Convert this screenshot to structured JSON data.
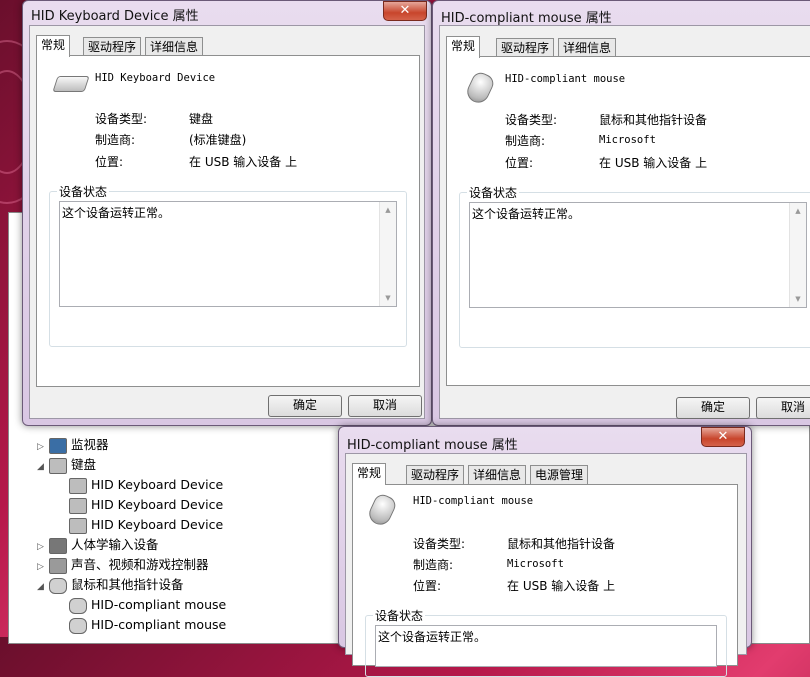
{
  "colors": {
    "accent": "#c8452c",
    "window_frame": "#d9c7e3"
  },
  "device_manager": {
    "tree": [
      {
        "label": "监视器",
        "indent": 0,
        "expanded": false,
        "icon": "monitor-icon"
      },
      {
        "label": "键盘",
        "indent": 0,
        "expanded": true,
        "icon": "keyboard-icon"
      },
      {
        "label": "HID Keyboard Device",
        "indent": 1,
        "icon": "keyboard-icon"
      },
      {
        "label": "HID Keyboard Device",
        "indent": 1,
        "icon": "keyboard-icon"
      },
      {
        "label": "HID Keyboard Device",
        "indent": 1,
        "icon": "keyboard-icon"
      },
      {
        "label": "人体学输入设备",
        "indent": 0,
        "expanded": false,
        "icon": "hid-icon"
      },
      {
        "label": "声音、视频和游戏控制器",
        "indent": 0,
        "expanded": false,
        "icon": "speaker-icon"
      },
      {
        "label": "鼠标和其他指针设备",
        "indent": 0,
        "expanded": true,
        "icon": "mouse-icon"
      },
      {
        "label": "HID-compliant mouse",
        "indent": 1,
        "icon": "mouse-icon"
      },
      {
        "label": "HID-compliant mouse",
        "indent": 1,
        "icon": "mouse-icon"
      }
    ]
  },
  "dialogs": {
    "keyboard": {
      "title": "HID Keyboard Device 属性",
      "close": "✕",
      "tabs": [
        "常规",
        "驱动程序",
        "详细信息"
      ],
      "device_name": "HID Keyboard Device",
      "type_label": "设备类型:",
      "type_value": "键盘",
      "maker_label": "制造商:",
      "maker_value": "(标准键盘)",
      "location_label": "位置:",
      "location_value": "在 USB 输入设备 上",
      "status_group": "设备状态",
      "status_text": "这个设备运转正常。",
      "ok": "确定",
      "cancel": "取消"
    },
    "mouse1": {
      "title": "HID-compliant mouse 属性",
      "tabs": [
        "常规",
        "驱动程序",
        "详细信息"
      ],
      "device_name": "HID-compliant mouse",
      "type_label": "设备类型:",
      "type_value": "鼠标和其他指针设备",
      "maker_label": "制造商:",
      "maker_value": "Microsoft",
      "location_label": "位置:",
      "location_value": "在 USB 输入设备 上",
      "status_group": "设备状态",
      "status_text": "这个设备运转正常。",
      "ok": "确定",
      "cancel": "取消"
    },
    "mouse2": {
      "title": "HID-compliant mouse 属性",
      "close": "✕",
      "tabs": [
        "常规",
        "驱动程序",
        "详细信息",
        "电源管理"
      ],
      "device_name": "HID-compliant mouse",
      "type_label": "设备类型:",
      "type_value": "鼠标和其他指针设备",
      "maker_label": "制造商:",
      "maker_value": "Microsoft",
      "location_label": "位置:",
      "location_value": "在 USB 输入设备 上",
      "status_group": "设备状态",
      "status_text": "这个设备运转正常。"
    }
  }
}
